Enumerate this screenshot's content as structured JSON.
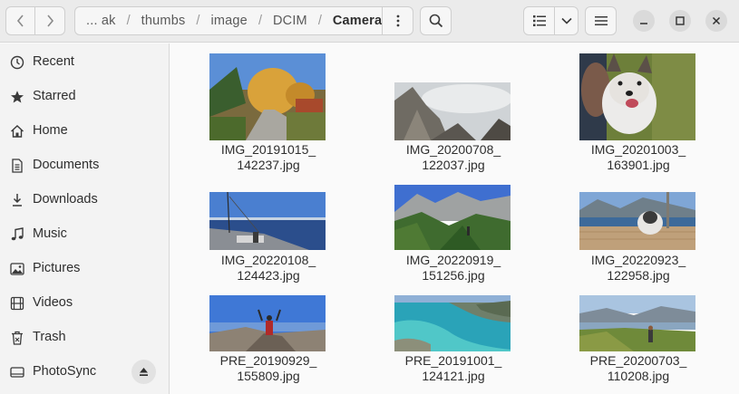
{
  "header": {
    "path": [
      "... ak",
      "thumbs",
      "image",
      "DCIM",
      "Camera"
    ],
    "icons": {
      "back": "chevron-left-icon",
      "forward": "chevron-right-icon",
      "path_menu": "vertical-ellipsis-icon",
      "search": "search-icon",
      "view": "list-view-icon",
      "view_dropdown": "chevron-down-icon",
      "menu": "hamburger-menu-icon",
      "minimize": "minimize-icon",
      "maximize": "maximize-icon",
      "close": "close-icon"
    }
  },
  "sidebar": {
    "items": [
      {
        "label": "Recent",
        "icon": "clock-icon"
      },
      {
        "label": "Starred",
        "icon": "star-icon"
      },
      {
        "label": "Home",
        "icon": "home-icon"
      },
      {
        "label": "Documents",
        "icon": "document-icon"
      },
      {
        "label": "Downloads",
        "icon": "download-icon"
      },
      {
        "label": "Music",
        "icon": "music-note-icon"
      },
      {
        "label": "Pictures",
        "icon": "picture-icon"
      },
      {
        "label": "Videos",
        "icon": "film-icon"
      },
      {
        "label": "Trash",
        "icon": "trash-icon"
      },
      {
        "label": "PhotoSync",
        "icon": "drive-icon",
        "eject_icon": "eject-icon"
      }
    ]
  },
  "files": [
    {
      "line1": "IMG_20191015_",
      "line2": "142237.jpg"
    },
    {
      "line1": "IMG_20200708_",
      "line2": "122037.jpg"
    },
    {
      "line1": "IMG_20201003_",
      "line2": "163901.jpg"
    },
    {
      "line1": "IMG_20220108_",
      "line2": "124423.jpg"
    },
    {
      "line1": "IMG_20220919_",
      "line2": "151256.jpg"
    },
    {
      "line1": "IMG_20220923_",
      "line2": "122958.jpg"
    },
    {
      "line1": "PRE_20190929_",
      "line2": "155809.jpg"
    },
    {
      "line1": "PRE_20191001_",
      "line2": "124121.jpg"
    },
    {
      "line1": "PRE_20200703_",
      "line2": "110208.jpg"
    }
  ]
}
